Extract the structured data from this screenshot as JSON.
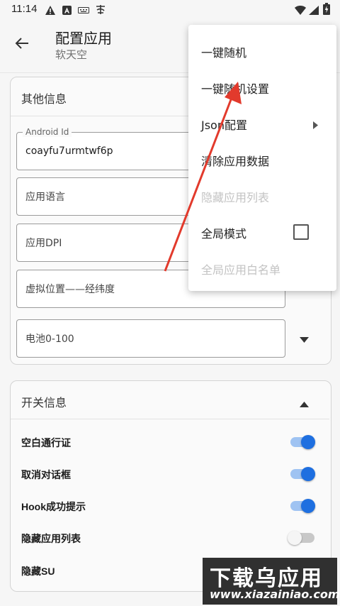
{
  "status_bar": {
    "time": "11:14"
  },
  "app_bar": {
    "title": "配置应用",
    "subtitle": "软天空"
  },
  "other_info": {
    "title": "其他信息",
    "fields": [
      {
        "label": "Android Id",
        "value": "coayfu7urmtwf6p"
      },
      {
        "placeholder": "应用语言"
      },
      {
        "placeholder": "应用DPI"
      },
      {
        "placeholder": "虚拟位置——经纬度"
      },
      {
        "placeholder": "电池0-100"
      }
    ]
  },
  "switch_info": {
    "title": "开关信息",
    "items": [
      {
        "label": "空白通行证",
        "on": true
      },
      {
        "label": "取消对话框",
        "on": true
      },
      {
        "label": "Hook成功提示",
        "on": true
      },
      {
        "label": "隐藏应用列表",
        "on": false
      },
      {
        "label": "隐藏SU",
        "on": false
      }
    ]
  },
  "menu": {
    "items": [
      {
        "label": "一键随机",
        "enabled": true
      },
      {
        "label": "一键随机设置",
        "enabled": true
      },
      {
        "label": "Json配置",
        "enabled": true,
        "submenu": true
      },
      {
        "label": "清除应用数据",
        "enabled": true
      },
      {
        "label": "隐藏应用列表",
        "enabled": false
      },
      {
        "label": "全局模式",
        "enabled": true,
        "checkbox": true,
        "checked": false
      },
      {
        "label": "全局应用白名单",
        "enabled": false
      }
    ]
  },
  "watermark": {
    "big": "下载乌应用",
    "small": "www.xiazainiao.com"
  },
  "colors": {
    "accent": "#1e6fe0",
    "track_on": "#9fc3f2",
    "track_off": "#c8c8c8",
    "arrow": "#e23a2c"
  }
}
